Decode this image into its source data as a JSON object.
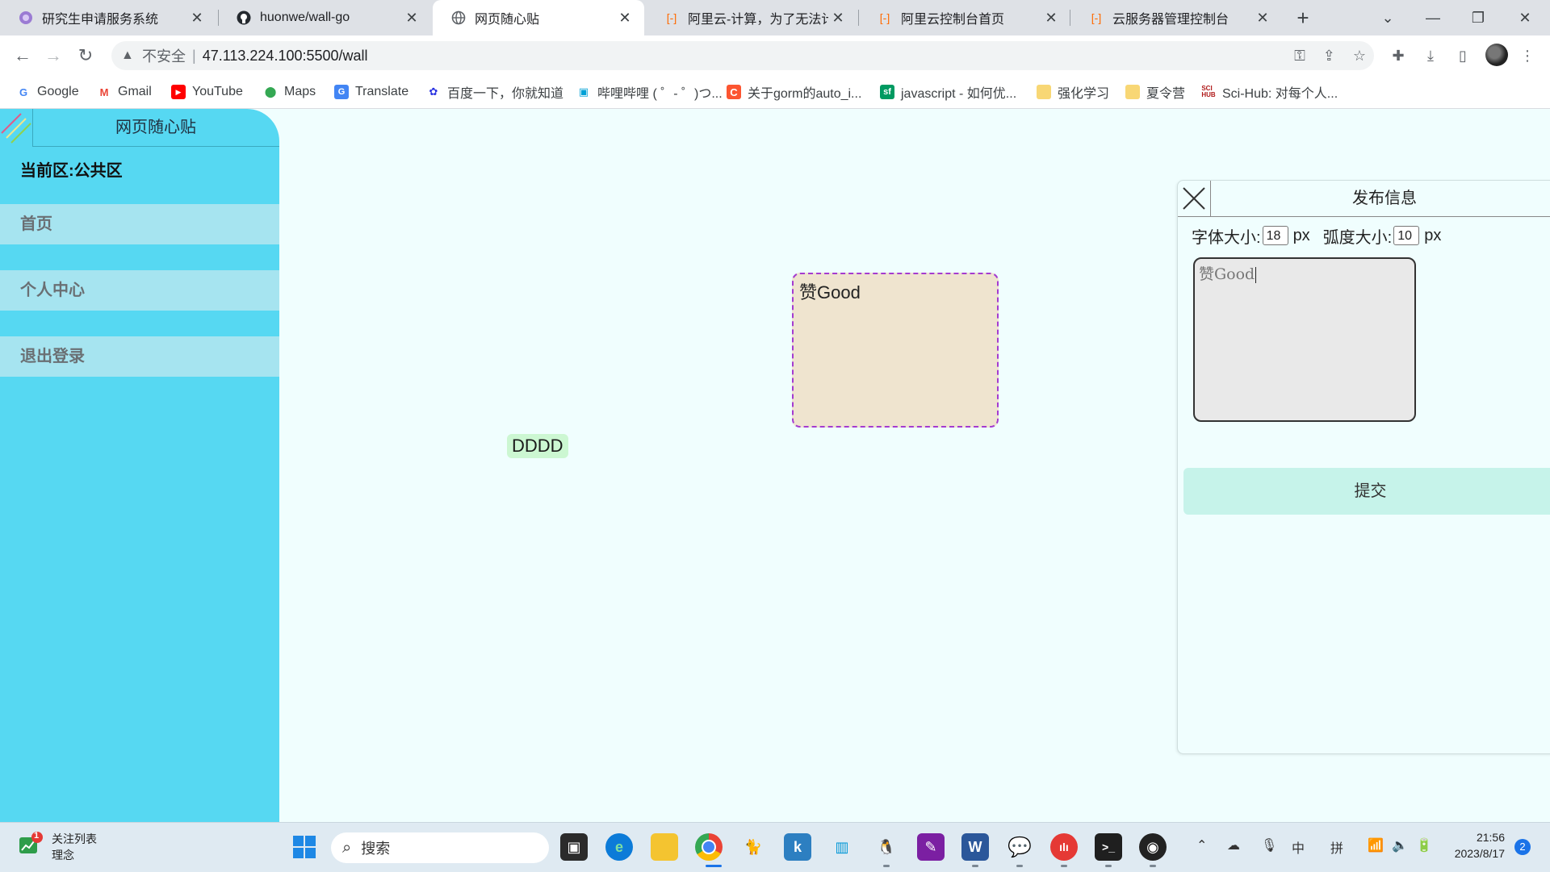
{
  "browser": {
    "tabs": [
      {
        "title": "研究生申请服务系统",
        "icon": "globe-purple-icon"
      },
      {
        "title": "huonwe/wall-go",
        "icon": "github-icon"
      },
      {
        "title": "网页随心贴",
        "icon": "globe-icon"
      },
      {
        "title": "阿里云-计算，为了无法计算",
        "icon": "aliyun-icon"
      },
      {
        "title": "阿里云控制台首页",
        "icon": "aliyun-icon"
      },
      {
        "title": "云服务器管理控制台",
        "icon": "aliyun-icon"
      }
    ],
    "active_tab": 2,
    "address": {
      "security": "不安全",
      "url": "47.113.224.100:5500/wall"
    },
    "bookmarks": [
      {
        "label": "Google",
        "icon": "google-icon"
      },
      {
        "label": "Gmail",
        "icon": "gmail-icon"
      },
      {
        "label": "YouTube",
        "icon": "youtube-icon"
      },
      {
        "label": "Maps",
        "icon": "maps-icon"
      },
      {
        "label": "Translate",
        "icon": "translate-icon"
      },
      {
        "label": "百度一下，你就知道",
        "icon": "baidu-icon"
      },
      {
        "label": "哔哩哔哩 ( ゜- ゜)つ...",
        "icon": "bilibili-icon"
      },
      {
        "label": "关于gorm的auto_i...",
        "icon": "csdn-icon"
      },
      {
        "label": "javascript - 如何优...",
        "icon": "segmentfault-icon"
      },
      {
        "label": "强化学习",
        "icon": "folder-icon"
      },
      {
        "label": "夏令营",
        "icon": "folder-icon"
      },
      {
        "label": "Sci-Hub: 对每个人...",
        "icon": "scihub-icon"
      }
    ]
  },
  "app": {
    "title": "网页随心贴",
    "zone": "当前区:公共区",
    "nav": [
      "首页",
      "个人中心",
      "退出登录"
    ]
  },
  "notes": [
    {
      "text": "DDDD",
      "bg": "#ccf7d2"
    },
    {
      "text": "赞Good",
      "bg": "#efe4cf",
      "border": "#a53bd0"
    }
  ],
  "panel": {
    "title": "发布信息",
    "font_size_label": "字体大小:",
    "font_size_value": "18",
    "radius_label": "弧度大小:",
    "radius_value": "10",
    "unit": "px",
    "content": "赞Good",
    "submit_label": "提交"
  },
  "taskbar": {
    "stock_title": "关注列表",
    "stock_sub": "理念",
    "stock_badge": "1",
    "search_placeholder": "搜索",
    "ime_lang": "中",
    "ime_mode": "拼",
    "time": "21:56",
    "date": "2023/8/17",
    "notification_count": "2"
  },
  "colors": {
    "sidebar": "#56d8f2",
    "sidebar_item": "#a6e4f0",
    "page_bg": "#f0fefe",
    "submit_bg": "#c6f3ea"
  }
}
